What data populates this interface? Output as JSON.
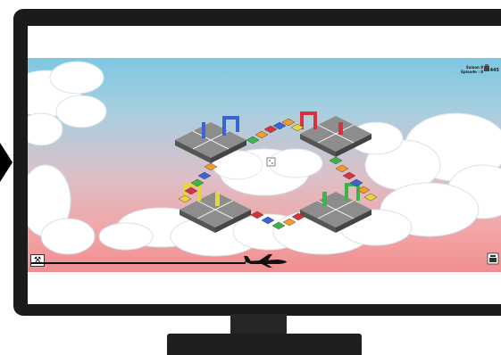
{
  "hud": {
    "line1": "Saison 8",
    "line2": "Episode : 8",
    "score": "445"
  },
  "icons": {
    "arrow": "play-pointer-icon",
    "tools": "tools-icon",
    "plane": "airplane-icon",
    "garage": "garage-icon",
    "dice": "dice-icon",
    "cup": "cup-icon"
  },
  "colors": {
    "blue": "#3a63d6",
    "red": "#d8333a",
    "yellow": "#e9d43a",
    "green": "#39b54a",
    "orange": "#f39a2b"
  }
}
